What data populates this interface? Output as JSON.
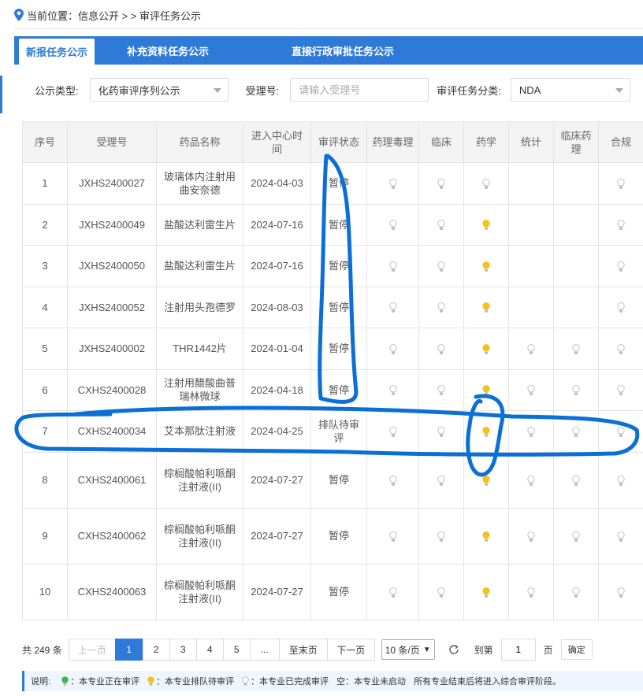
{
  "breadcrumb": {
    "prefix": "当前位置：信息公开 > > 审评任务公示"
  },
  "tabs": [
    {
      "label": "新报任务公示"
    },
    {
      "label": "补充资料任务公示"
    },
    {
      "label": "直接行政审批任务公示"
    }
  ],
  "filters": {
    "type_label": "公示类型:",
    "type_value": "化药审评序列公示",
    "accept_label": "受理号:",
    "accept_placeholder": "请输入受理号",
    "category_label": "审评任务分类:",
    "category_value": "NDA"
  },
  "table": {
    "headers": [
      "序号",
      "受理号",
      "药品名称",
      "进入中心时间",
      "审评状态",
      "药理毒理",
      "临床",
      "药学",
      "统计",
      "临床药理",
      "合规"
    ],
    "rows": [
      {
        "no": "1",
        "id": "JXHS2400027",
        "name": "玻璃体内注射用曲安奈德",
        "date": "2024-04-03",
        "status": "暂停",
        "bulbs": [
          "done",
          "done",
          "done",
          "",
          "",
          "done"
        ]
      },
      {
        "no": "2",
        "id": "JXHS2400049",
        "name": "盐酸达利雷生片",
        "date": "2024-07-16",
        "status": "暂停",
        "bulbs": [
          "done",
          "done",
          "queue",
          "",
          "",
          "done"
        ]
      },
      {
        "no": "3",
        "id": "JXHS2400050",
        "name": "盐酸达利雷生片",
        "date": "2024-07-16",
        "status": "暂停",
        "bulbs": [
          "done",
          "done",
          "queue",
          "",
          "",
          "done"
        ]
      },
      {
        "no": "4",
        "id": "JXHS2400052",
        "name": "注射用头孢德罗",
        "date": "2024-08-03",
        "status": "暂停",
        "bulbs": [
          "done",
          "done",
          "queue",
          "",
          "",
          "done"
        ]
      },
      {
        "no": "5",
        "id": "JXHS2400002",
        "name": "THR1442片",
        "date": "2024-01-04",
        "status": "暂停",
        "bulbs": [
          "done",
          "done",
          "queue",
          "done",
          "done",
          "done"
        ]
      },
      {
        "no": "6",
        "id": "CXHS2400028",
        "name": "注射用醋酸曲普瑞林微球",
        "date": "2024-04-18",
        "status": "暂停",
        "bulbs": [
          "done",
          "done",
          "queue",
          "done",
          "done",
          "done"
        ]
      },
      {
        "no": "7",
        "id": "CXHS2400034",
        "name": "艾本那肽注射液",
        "date": "2024-04-25",
        "status": "排队待审评",
        "bulbs": [
          "done",
          "done",
          "queue",
          "done",
          "done",
          "done"
        ]
      },
      {
        "no": "8",
        "id": "CXHS2400061",
        "name": "棕榈酸帕利哌酮注射液(II)",
        "date": "2024-07-27",
        "status": "暂停",
        "bulbs": [
          "done",
          "done",
          "queue",
          "done",
          "done",
          "done"
        ]
      },
      {
        "no": "9",
        "id": "CXHS2400062",
        "name": "棕榈酸帕利哌酮注射液(II)",
        "date": "2024-07-27",
        "status": "暂停",
        "bulbs": [
          "done",
          "done",
          "queue",
          "done",
          "done",
          "done"
        ]
      },
      {
        "no": "10",
        "id": "CXHS2400063",
        "name": "棕榈酸帕利哌酮注射液(II)",
        "date": "2024-07-27",
        "status": "暂停",
        "bulbs": [
          "done",
          "done",
          "queue",
          "done",
          "done",
          "done"
        ]
      }
    ]
  },
  "pagination": {
    "total": "共 249 条",
    "prev": "上一页",
    "pages": [
      "1",
      "2",
      "3",
      "4",
      "5",
      "..."
    ],
    "last": "至末页",
    "next": "下一页",
    "page_size": "10 条/页",
    "goto_label": "到第",
    "goto_value": "1",
    "page_label": "页",
    "confirm": "确定"
  },
  "legend": {
    "title": "说明:",
    "in_review": "：本专业正在审评",
    "queued": "：本专业排队待审评",
    "done": "：本专业已完成审评",
    "empty": "空：本专业未启动",
    "note": "所有专业结束后将进入综合审评阶段。"
  },
  "colors": {
    "accent": "#2f7ad9",
    "bulb_done": "#cfcfcf",
    "bulb_queue": "#f2c319",
    "bulb_review": "#3fb34f"
  },
  "icons": [
    "location-pin-icon",
    "bulb-icon",
    "refresh-icon",
    "chevron-down-icon"
  ]
}
